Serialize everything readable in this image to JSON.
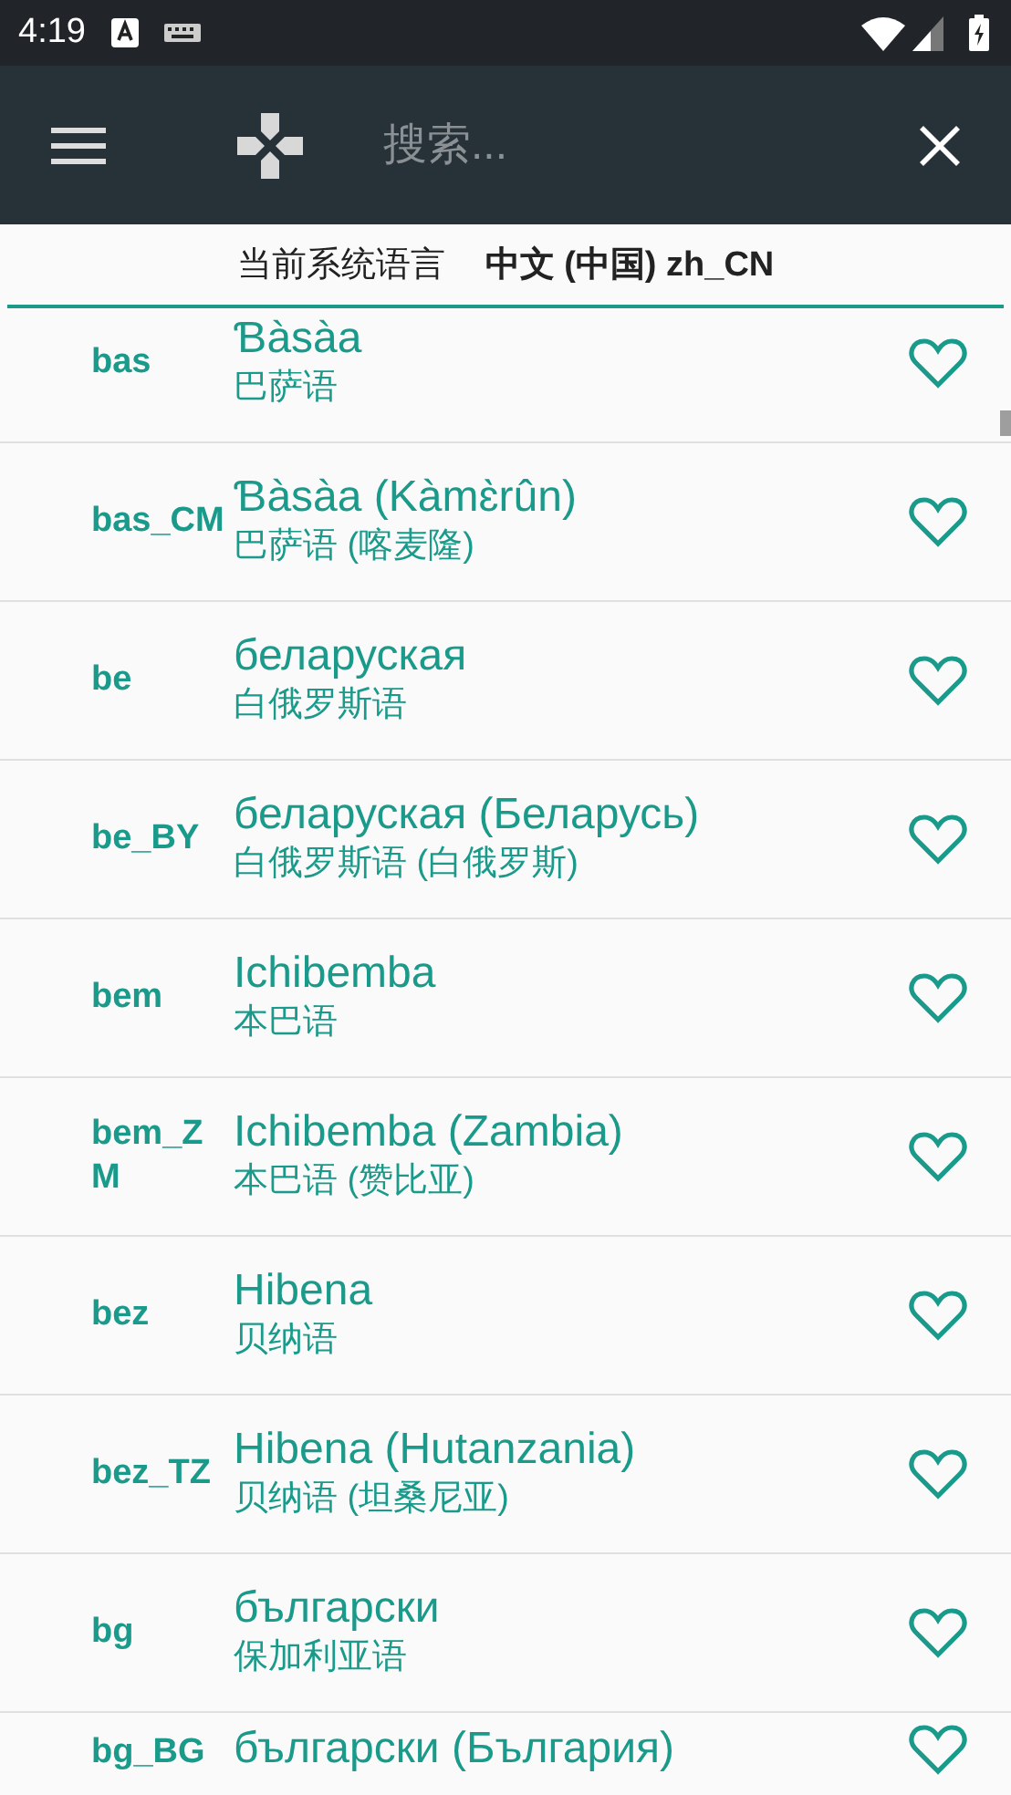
{
  "status_bar": {
    "time": "4:19"
  },
  "toolbar": {
    "search": {
      "placeholder": "搜索..."
    }
  },
  "current_language": {
    "label": "当前系统语言",
    "value": "中文 (中国) zh_CN"
  },
  "languages": [
    {
      "code": "bas",
      "name": "Ɓàsàa",
      "translation": "巴萨语",
      "favorite": false
    },
    {
      "code": "bas_CM",
      "name": "Ɓàsàa (Kàmɛ̀rûn)",
      "translation": "巴萨语 (喀麦隆)",
      "favorite": false
    },
    {
      "code": "be",
      "name": "беларуская",
      "translation": "白俄罗斯语",
      "favorite": false
    },
    {
      "code": "be_BY",
      "name": "беларуская (Беларусь)",
      "translation": "白俄罗斯语 (白俄罗斯)",
      "favorite": false
    },
    {
      "code": "bem",
      "name": "Ichibemba",
      "translation": "本巴语",
      "favorite": false
    },
    {
      "code": "bem_ZM",
      "name": "Ichibemba (Zambia)",
      "translation": "本巴语 (赞比亚)",
      "favorite": false
    },
    {
      "code": "bez",
      "name": "Hibena",
      "translation": "贝纳语",
      "favorite": false
    },
    {
      "code": "bez_TZ",
      "name": "Hibena (Hutanzania)",
      "translation": "贝纳语 (坦桑尼亚)",
      "favorite": false
    },
    {
      "code": "bg",
      "name": "български",
      "translation": "保加利亚语",
      "favorite": false
    },
    {
      "code": "bg_BG",
      "name": "български (България)",
      "favorite": false
    }
  ]
}
